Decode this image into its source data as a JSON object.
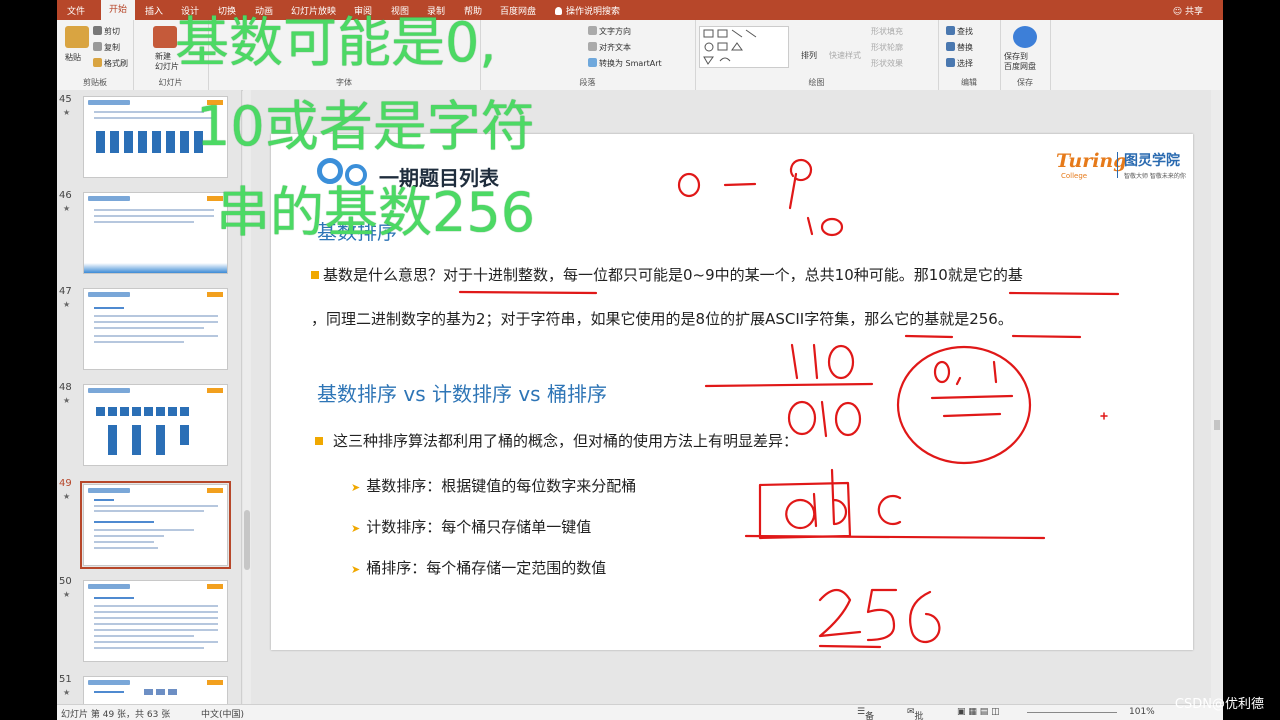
{
  "tabs": [
    "文件",
    "开始",
    "插入",
    "设计",
    "切换",
    "动画",
    "幻灯片放映",
    "审阅",
    "视图",
    "录制",
    "帮助",
    "百度网盘"
  ],
  "active_tab": "开始",
  "tell_me": "操作说明搜索",
  "share": "共享",
  "ribbon": {
    "paste": "粘贴",
    "cut": "剪切",
    "copy": "复制",
    "format_painter": "格式刷",
    "clipboard": "剪贴板",
    "new_slide": "新建\n幻灯片",
    "slides_group": "幻灯片",
    "font_group": "字体",
    "paragraph_group": "段落",
    "text_direction": "文字方向",
    "align_text": "对齐文本",
    "smartart": "转换为 SmartArt",
    "drawing_group": "绘图",
    "arrange": "排列",
    "quick_styles": "快速样式",
    "shape_fill": "形状填充",
    "shape_outline": "形状轮廓",
    "shape_effects": "形状效果",
    "find": "查找",
    "replace": "替换",
    "select": "选择",
    "editing_group": "编辑",
    "save_baidu": "保存到\n百度网盘",
    "save_group": "保存"
  },
  "thumbnails": [
    {
      "num": "45"
    },
    {
      "num": "46"
    },
    {
      "num": "47"
    },
    {
      "num": "48"
    },
    {
      "num": "49"
    },
    {
      "num": "50"
    },
    {
      "num": "51"
    }
  ],
  "selected_thumbnail": "49",
  "slide": {
    "title": "一期题目列表",
    "logo_en": "Turing",
    "logo_college": "College",
    "logo_cn": "图灵学院",
    "logo_tag": "智敬大师 智敬未来的你",
    "section1": "基数排序",
    "para1_line1_a": "基数是什么意思？",
    "para1_line1_b": "对于十进制整数，每一位都只可能是0~9中的某一个，总共10种可能。那10就是它的基",
    "para1_line2": "，同理二进制数字的基为2；对于字符串，如果它使用的是8位的扩展ASCII字符集，那么它的基就是256。",
    "section2": "基数排序 vs 计数排序 vs 桶排序",
    "para2": "这三种排序算法都利用了桶的概念，但对桶的使用方法上有明显差异：",
    "items": [
      "基数排序：根据键值的每位数字来分配桶",
      "计数排序：每个桶只存储单一键值",
      "桶排序：每个桶存储一定范围的数值"
    ]
  },
  "status": {
    "slide_info": "幻灯片 第 49 张，共 63 张",
    "language": "中文(中国)",
    "notes": "备注",
    "comments": "批注",
    "zoom": "101%"
  },
  "overlay": {
    "line1": "基数可能是0,",
    "line2": "10或者是字符",
    "line3": "串的基数256"
  },
  "watermark": "CSDN@优利德",
  "colors": {
    "accent": "#b7472a",
    "overlay_green": "#4cd964",
    "ink_red": "#e01818",
    "heading_blue": "#2e75b6"
  }
}
